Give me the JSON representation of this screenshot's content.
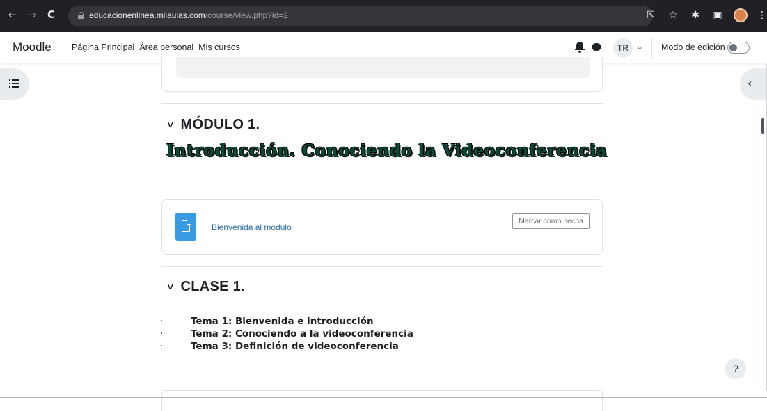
{
  "browser": {
    "url_host": "educacionenlinea.milaulas.com",
    "url_path": "/course/view.php?id=2"
  },
  "header": {
    "brand": "Moodle",
    "nav": [
      "Página Principal",
      "Área personal",
      "Mis cursos"
    ],
    "user_initials": "TR",
    "edit_mode_label": "Modo de edición"
  },
  "sections": [
    {
      "title": "MÓDULO 1.",
      "subtitle": "Introducción. Conociendo la Videoconferencia",
      "activity": {
        "name": "Bienvenida al módulo",
        "completion_button": "Marcar como hecha"
      }
    },
    {
      "title": "CLASE 1.",
      "bullet": "·",
      "topics": [
        "Tema 1: Bienvenida e introducción",
        "Tema 2: Conociendo a la videoconferencia",
        "Tema 3: Definición de videoconferencia"
      ]
    }
  ],
  "help_label": "?",
  "icons": {
    "back": "arrow-left-icon",
    "forward": "arrow-right-icon",
    "reload": "reload-icon",
    "share": "share-icon",
    "bookmark": "star-icon",
    "extensions": "puzzle-icon",
    "sidepanel": "sidepanel-icon",
    "notifications": "bell-icon",
    "messages": "chat-icon",
    "course_index": "list-icon",
    "block_drawer": "chevron-left-icon",
    "collapse": "chevron-down-icon",
    "page": "file-icon"
  },
  "colors": {
    "activity_icon": "#399be2",
    "link": "#2d6d9e",
    "decorative_title": "#0b4a3a"
  }
}
